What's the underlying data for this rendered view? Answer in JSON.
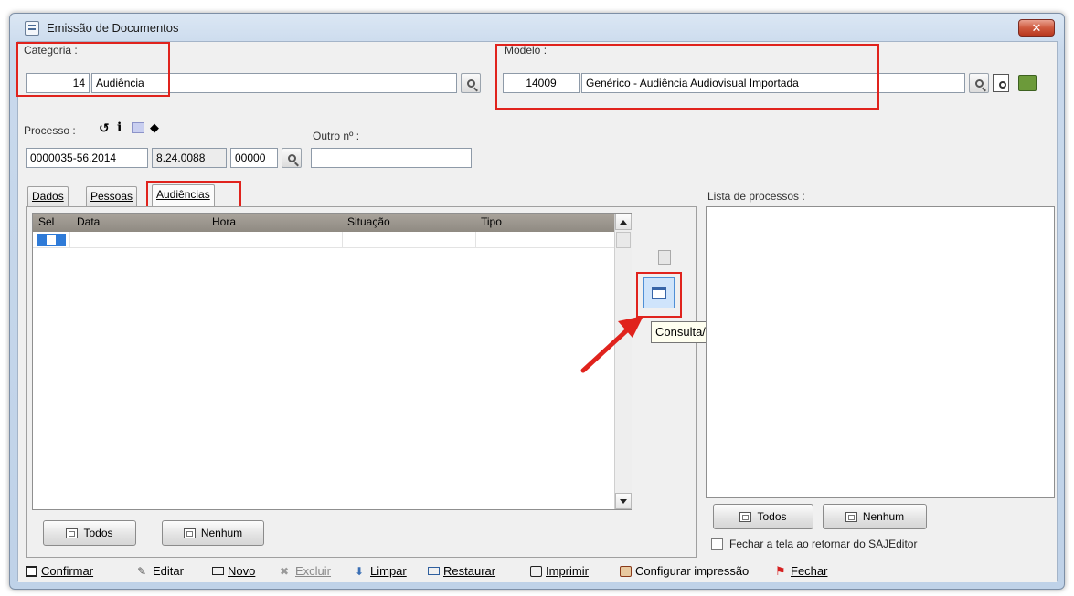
{
  "window": {
    "title": "Emissão de Documentos",
    "close_glyph": "✕"
  },
  "categoria": {
    "label": "Categoria :",
    "code": "14",
    "name": "Audiência"
  },
  "modelo": {
    "label": "Modelo :",
    "code": "14009",
    "name": "Genérico - Audiência Audiovisual Importada"
  },
  "processo": {
    "label": "Processo :",
    "part1": "0000035-56.2014",
    "part2": "8.24.0088",
    "part3": "00000",
    "outro_label": "Outro nº :",
    "outro_value": ""
  },
  "tabs": [
    {
      "label": "Dados"
    },
    {
      "label": "Pessoas"
    },
    {
      "label": "Audiências"
    }
  ],
  "grid": {
    "columns": [
      "Sel",
      "Data",
      "Hora",
      "Situação",
      "Tipo"
    ]
  },
  "left_buttons": {
    "todos": "Todos",
    "nenhum": "Nenhum"
  },
  "right_panel": {
    "label": "Lista de processos :",
    "todos": "Todos",
    "nenhum": "Nenhum",
    "checkbox_label": "Fechar a tela ao retornar do SAJEditor"
  },
  "tooltip": "Consulta/Cadastro de Audiências do Processo",
  "bottom_toolbar": [
    {
      "label": "Confirmar",
      "icon": "save-icon",
      "enabled": true
    },
    {
      "label": "Editar",
      "icon": "edit-icon",
      "enabled": true
    },
    {
      "label": "Novo",
      "icon": "new-icon",
      "enabled": true
    },
    {
      "label": "Excluir",
      "icon": "delete-icon",
      "enabled": false
    },
    {
      "label": "Limpar",
      "icon": "clear-icon",
      "enabled": true
    },
    {
      "label": "Restaurar",
      "icon": "restore-icon",
      "enabled": true
    },
    {
      "label": "Imprimir",
      "icon": "print-icon",
      "enabled": true
    },
    {
      "label": "Configurar impressão",
      "icon": "print-settings-icon",
      "enabled": true
    },
    {
      "label": "Fechar",
      "icon": "close-pin-icon",
      "enabled": true
    }
  ],
  "colors": {
    "highlight": "#e0231d",
    "grid_header": "#8f8a82",
    "tooltip_bg": "#fffff0"
  }
}
